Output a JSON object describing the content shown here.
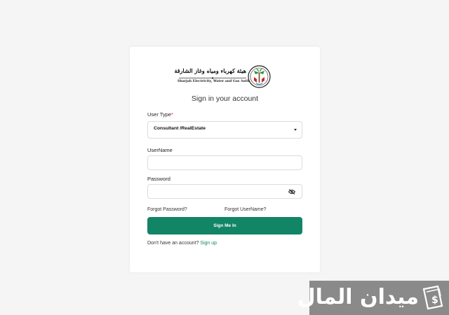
{
  "logo": {
    "arabic_name": "هيئة كهرباء ومياه وغاز الشارقة",
    "english_name": "Sharjah Electricity, Water and Gas Authority"
  },
  "login": {
    "heading": "Sign in your account",
    "user_type_label": "User Type",
    "required_mark": "*",
    "user_type_value": "Consultant /RealEstate",
    "username_label": "UserName",
    "username_value": "",
    "password_label": "Password",
    "password_value": "",
    "forgot_password": "Forgot Password?",
    "forgot_username": "Forgot UserName?",
    "sign_in_button": "Sign Me In",
    "no_account_text": "Don't have an account?",
    "sign_up_link": "Sign up"
  },
  "watermark": {
    "text": "ميدان المال"
  },
  "colors": {
    "accent": "#138567",
    "background": "#f5f5f6",
    "card": "#ffffff",
    "required": "#dd3333"
  },
  "icons": {
    "dropdown": "caret-down-icon",
    "password_toggle": "eye-slash-icon",
    "logo": "sewa-emblem-icon",
    "watermark": "money-bag-icon"
  }
}
